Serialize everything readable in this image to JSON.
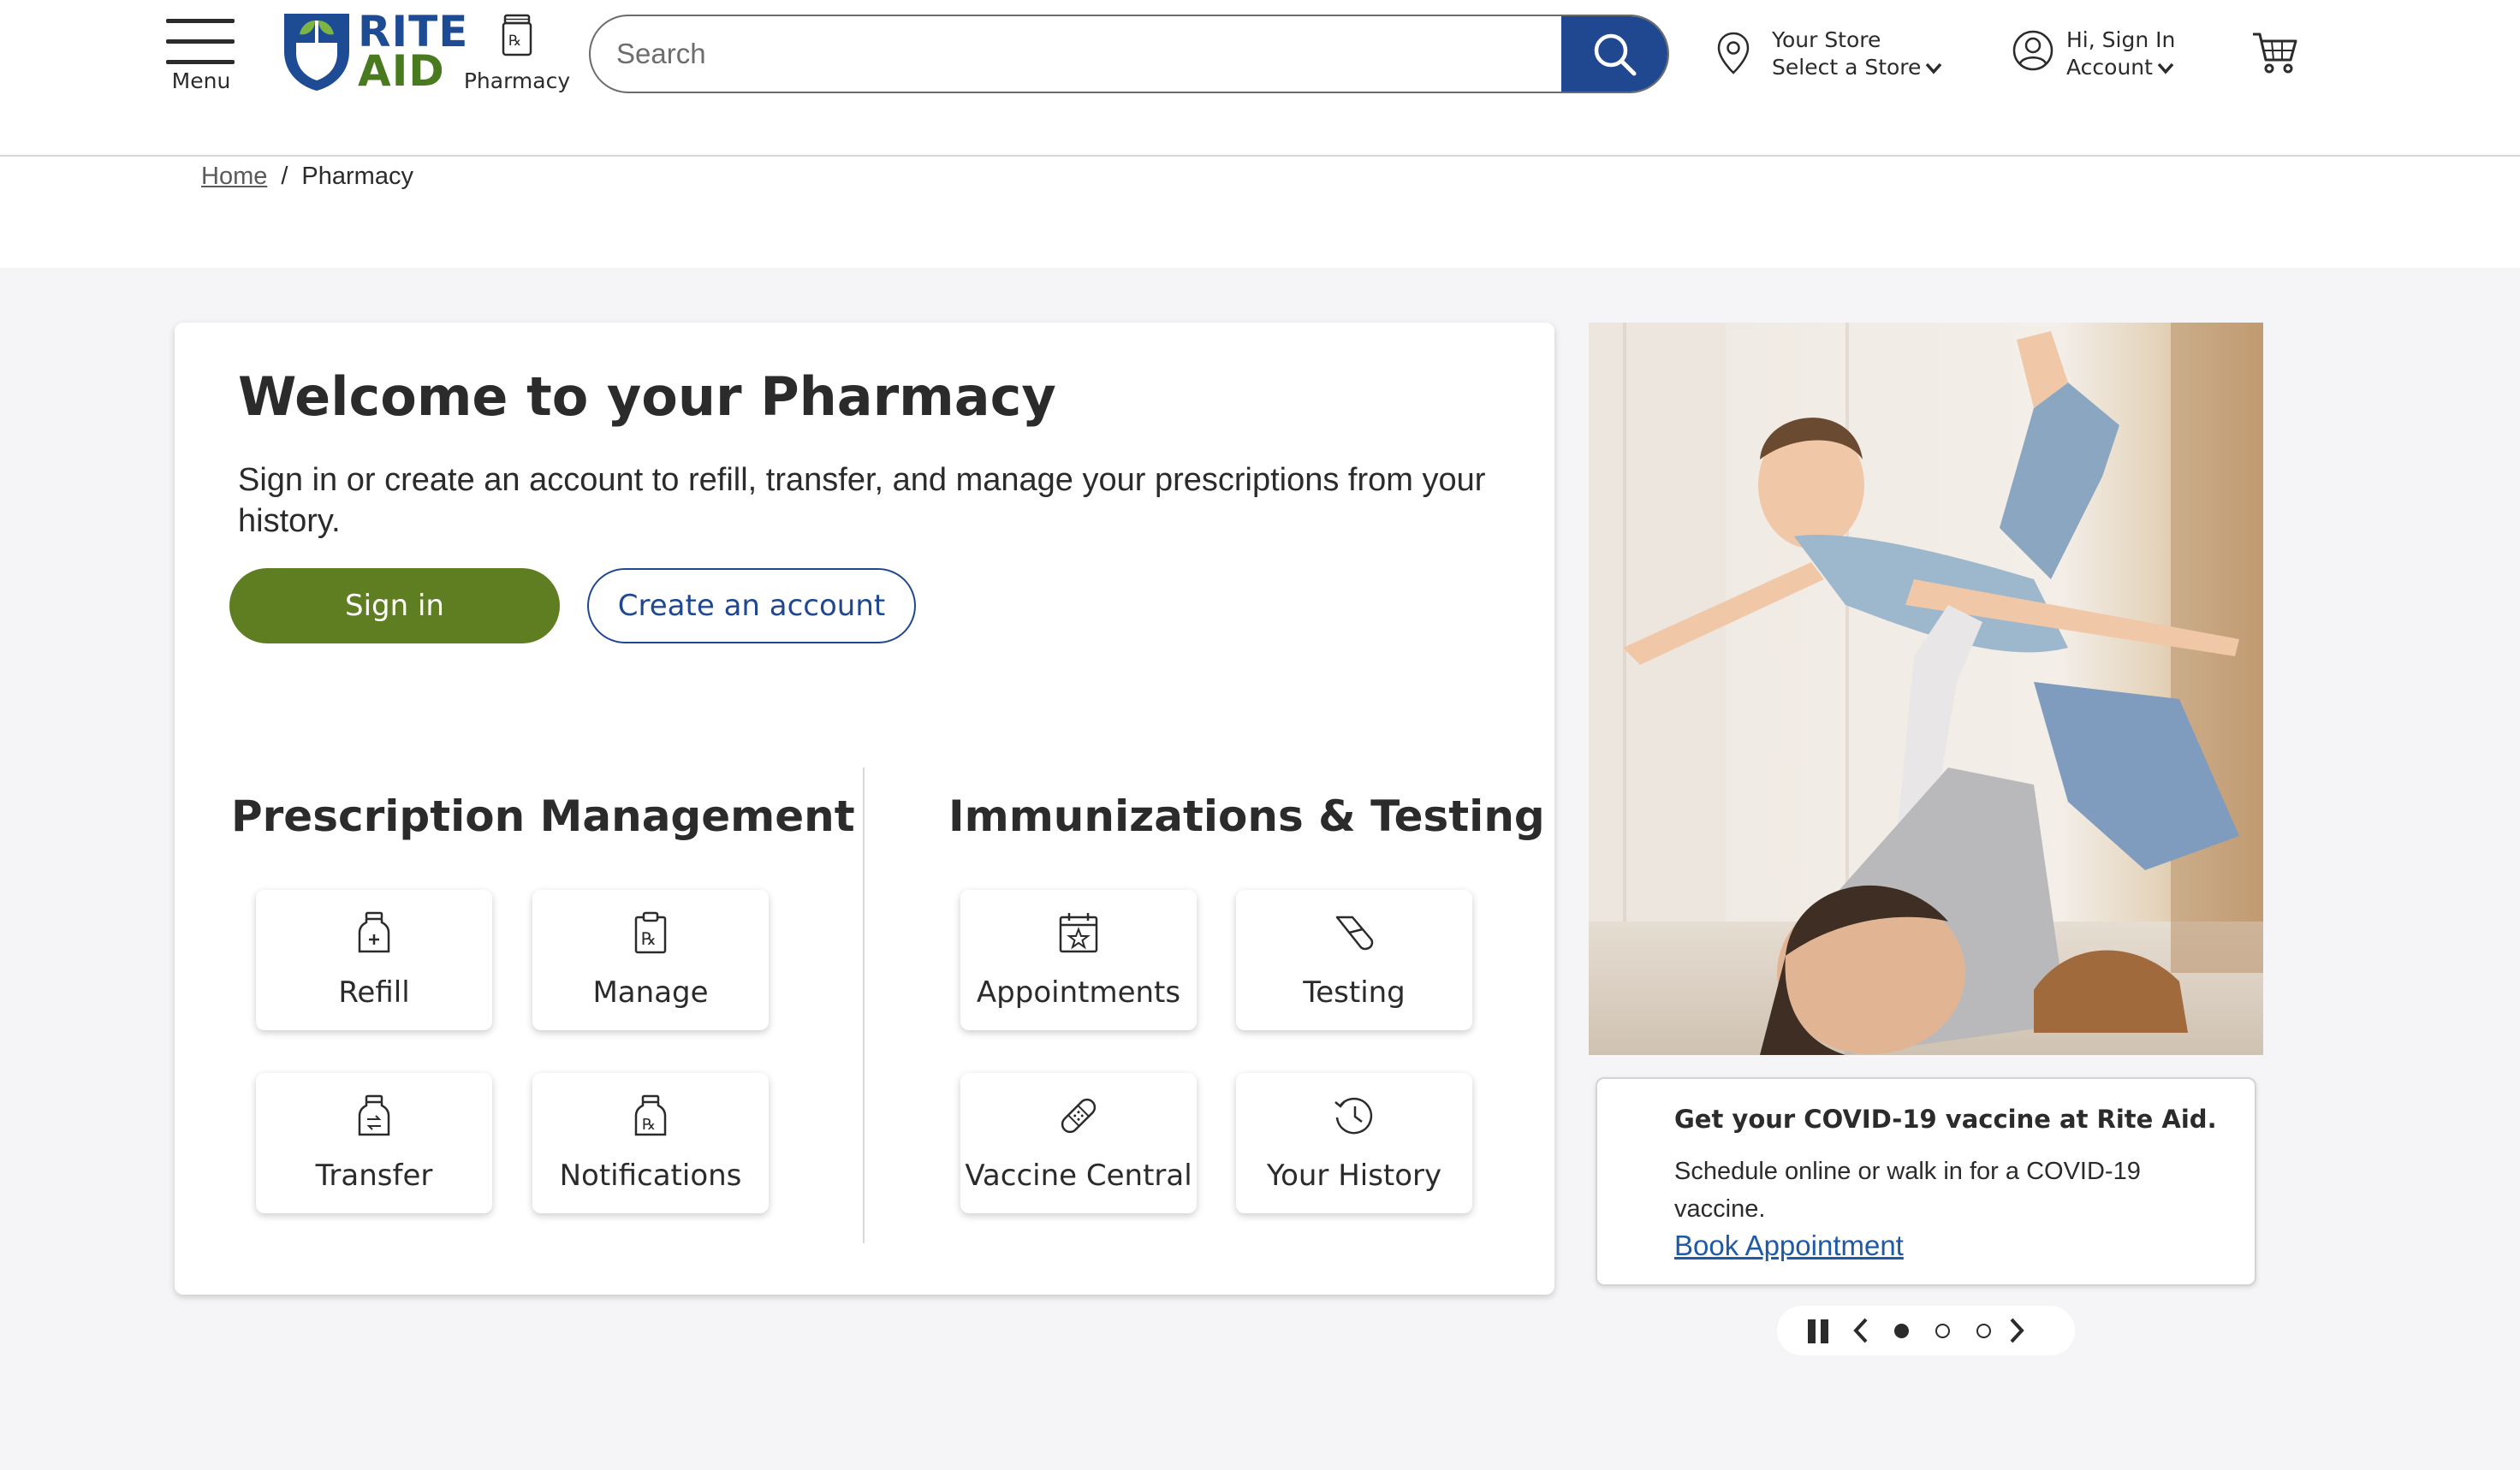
{
  "header": {
    "menu_label": "Menu",
    "logo_line1": "RITE",
    "logo_line2": "AID",
    "pharmacy_label": "Pharmacy",
    "search_placeholder": "Search",
    "store_line1": "Your Store",
    "store_line2": "Select a Store",
    "account_line1": "Hi, Sign In",
    "account_line2": "Account"
  },
  "breadcrumb": {
    "home": "Home",
    "separator": "/",
    "current": "Pharmacy"
  },
  "welcome": {
    "title": "Welcome to your Pharmacy",
    "description": "Sign in or create an account to refill, transfer, and manage your prescriptions from your history.",
    "signin_label": "Sign in",
    "create_label": "Create an account"
  },
  "prescription": {
    "title": "Prescription Management",
    "tiles": [
      {
        "label": "Refill",
        "icon": "refill-bottle-icon"
      },
      {
        "label": "Manage",
        "icon": "rx-clipboard-icon"
      },
      {
        "label": "Transfer",
        "icon": "transfer-bottle-icon"
      },
      {
        "label": "Notifications",
        "icon": "rx-bottle-icon"
      }
    ]
  },
  "immunizations": {
    "title": "Immunizations & Testing",
    "tiles": [
      {
        "label": "Appointments",
        "icon": "calendar-star-icon"
      },
      {
        "label": "Testing",
        "icon": "test-swab-icon"
      },
      {
        "label": "Vaccine Central",
        "icon": "bandage-icon"
      },
      {
        "label": "Your History",
        "icon": "history-clock-icon"
      }
    ]
  },
  "promo": {
    "heading": "Get your COVID-19 vaccine at Rite Aid.",
    "body": "Schedule online or walk in for a COVID-19 vaccine.",
    "link": "Book Appointment",
    "slides_total": 3,
    "active_slide": 1
  },
  "colors": {
    "brand_blue": "#1f4891",
    "brand_green": "#5f7e21",
    "link_blue": "#1f5aa6",
    "page_bg": "#f5f5f7"
  }
}
